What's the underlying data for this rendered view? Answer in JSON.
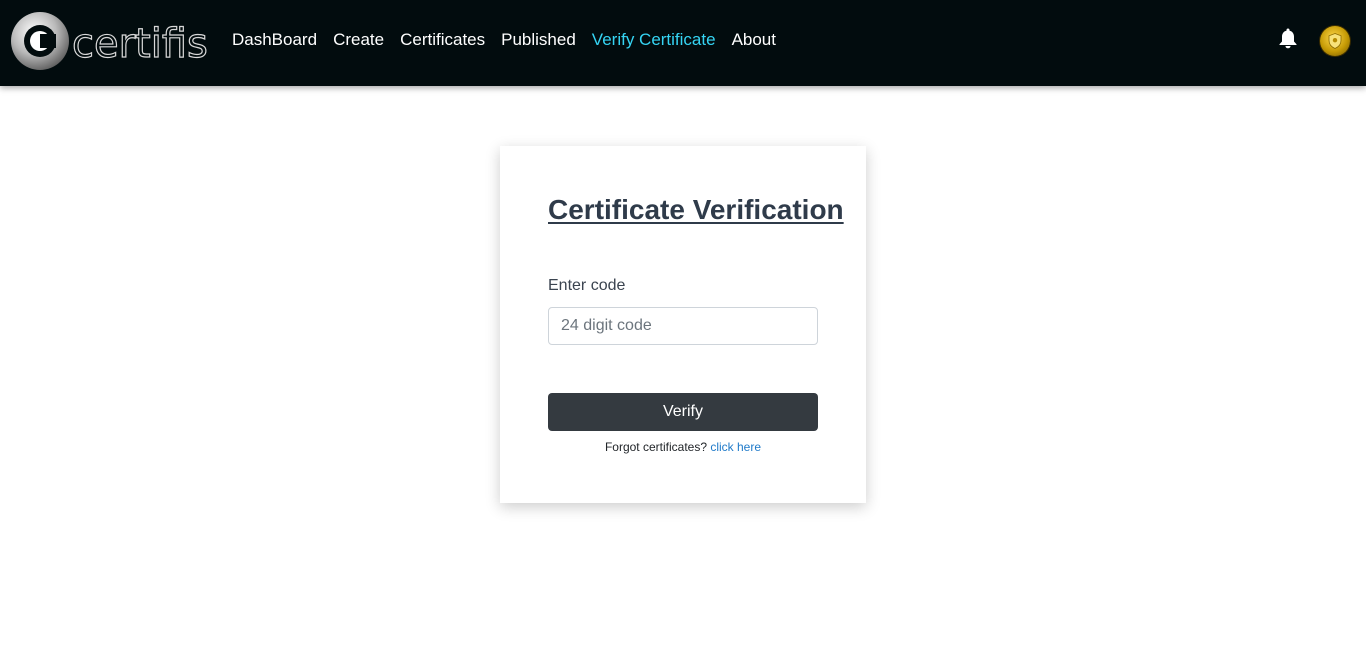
{
  "brand": {
    "name": "certifis"
  },
  "nav": {
    "items": [
      {
        "label": "DashBoard",
        "active": false
      },
      {
        "label": "Create",
        "active": false
      },
      {
        "label": "Certificates",
        "active": false
      },
      {
        "label": "Published",
        "active": false
      },
      {
        "label": "Verify Certificate",
        "active": true
      },
      {
        "label": "About",
        "active": false
      }
    ],
    "notification_icon": "bell-icon",
    "avatar_icon": "shield-badge-icon"
  },
  "form": {
    "title": "Certificate Verification",
    "code_label": "Enter code",
    "code_value": "",
    "code_placeholder": "24 digit code",
    "submit_label": "Verify",
    "forgot_text": "Forgot certificates?",
    "forgot_link": "click here"
  },
  "colors": {
    "navbar_bg": "#020c0e",
    "nav_active": "#35d4f3",
    "button_bg": "#343a40",
    "link": "#1f7ac9"
  }
}
